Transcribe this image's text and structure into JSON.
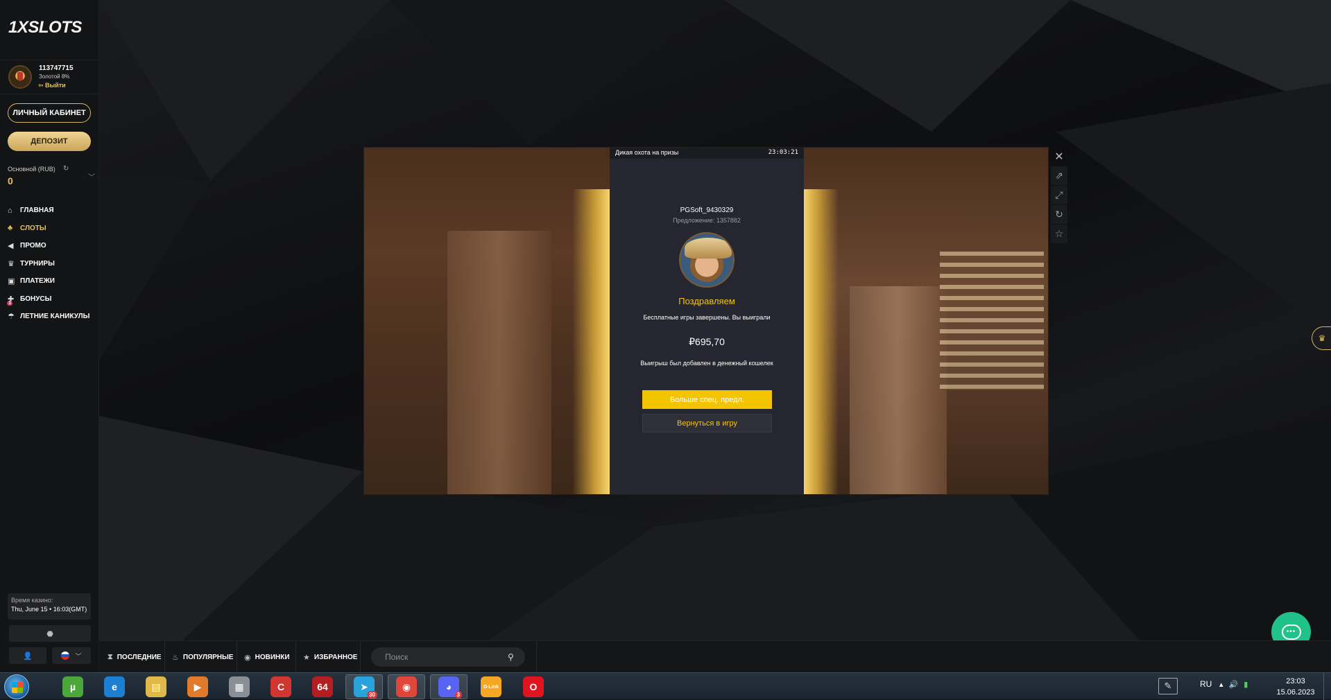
{
  "sidebar": {
    "logo": "1XSLOTS",
    "user": {
      "id": "113747715",
      "level": "Золотой 8%",
      "logout": "Выйти"
    },
    "cabinet_button": "ЛИЧНЫЙ КАБИНЕТ",
    "deposit_button": "ДЕПОЗИТ",
    "balance": {
      "label": "Основной (RUB)",
      "value": "0"
    },
    "nav": [
      {
        "label": "ГЛАВНАЯ",
        "icon": "home-icon",
        "active": false
      },
      {
        "label": "СЛОТЫ",
        "icon": "cherries-icon",
        "active": true
      },
      {
        "label": "ПРОМО",
        "icon": "megaphone-icon",
        "active": false
      },
      {
        "label": "ТУРНИРЫ",
        "icon": "trophy-icon",
        "active": false
      },
      {
        "label": "ПЛАТЕЖИ",
        "icon": "wallet-icon",
        "active": false
      },
      {
        "label": "БОНУСЫ",
        "icon": "gift-icon",
        "active": false,
        "badge": "1"
      },
      {
        "label": "ЛЕТНИЕ КАНИКУЛЫ",
        "icon": "beach-icon",
        "active": false
      }
    ],
    "casino_time": {
      "label": "Время казино:",
      "value": "Thu, June 15 • 16:03(GMT)"
    }
  },
  "modal": {
    "title": "Дикая охота на призы",
    "clock": "23:03:21",
    "provider": "PGSoft_9430329",
    "offer": "Предложение: 1357882",
    "congrats": "Поздравляем",
    "free_games_over": "Бесплатные игры завершены. Вы выиграли",
    "win_amount": "₽695,70",
    "wallet_note": "Выигрыш был добавлен в денежный кошелек",
    "more_button": "Больше спец. предл.",
    "back_button": "Вернуться в игру"
  },
  "frame_tools": [
    "close-icon",
    "share-icon",
    "fullscreen-icon",
    "refresh-icon",
    "star-icon"
  ],
  "bottombar": {
    "recent": "ПОСЛЕДНИЕ",
    "popular": "ПОПУЛЯРНЫЕ",
    "new": "НОВИНКИ",
    "favorites": "ИЗБРАННОЕ",
    "search_placeholder": "Поиск"
  },
  "taskbar": {
    "apps": [
      {
        "name": "utorrent-icon",
        "color": "#4aa83a",
        "glyph": "µ"
      },
      {
        "name": "internet-explorer-icon",
        "color": "#1d7fd1",
        "glyph": "e"
      },
      {
        "name": "file-explorer-icon",
        "color": "#e0b84a",
        "glyph": "▤"
      },
      {
        "name": "media-player-icon",
        "color": "#e07a2c",
        "glyph": "▶"
      },
      {
        "name": "archive-icon",
        "color": "#8a8f96",
        "glyph": "▦"
      },
      {
        "name": "ccleaner-icon",
        "color": "#d0362f",
        "glyph": "C"
      },
      {
        "name": "aida64-icon",
        "color": "#b31e23",
        "glyph": "64"
      },
      {
        "name": "telegram-icon",
        "color": "#2aa3dc",
        "glyph": "➤",
        "badge": "30"
      },
      {
        "name": "chrome-icon",
        "color": "#e0453a",
        "glyph": "◉"
      },
      {
        "name": "discord-icon",
        "color": "#5865f2",
        "glyph": "◕",
        "badge": "3"
      },
      {
        "name": "dlink-icon",
        "color": "#f5a623",
        "glyph": "D-Link"
      },
      {
        "name": "opera-icon",
        "color": "#e0141e",
        "glyph": "O"
      }
    ],
    "lang": "RU",
    "time": "23:03",
    "date": "15.06.2023"
  },
  "colors": {
    "accent_gold": "#e6c35a",
    "cta_yellow": "#f5c400",
    "chat_green": "#21c28a"
  }
}
